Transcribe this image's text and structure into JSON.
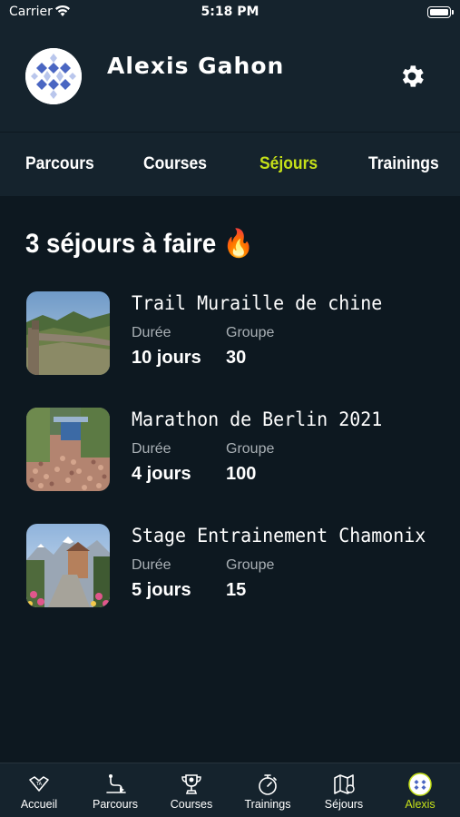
{
  "status_bar": {
    "carrier": "Carrier",
    "time": "5:18 PM"
  },
  "profile": {
    "name": "Alexis Gahon"
  },
  "tabs": [
    {
      "label": "Parcours",
      "active": false
    },
    {
      "label": "Courses",
      "active": false
    },
    {
      "label": "Séjours",
      "active": true
    },
    {
      "label": "Trainings",
      "active": false
    }
  ],
  "main": {
    "title": "3 séjours à faire 🔥"
  },
  "labels": {
    "duration": "Durée",
    "group": "Groupe"
  },
  "trips": [
    {
      "title": "Trail Muraille de chine",
      "duration": "10 jours",
      "group": "30",
      "image": "great-wall-photo"
    },
    {
      "title": "Marathon de Berlin 2021",
      "duration": "4 jours",
      "group": "100",
      "image": "marathon-crowd-photo"
    },
    {
      "title": "Stage Entrainement Chamonix",
      "duration": "5 jours",
      "group": "15",
      "image": "chamonix-photo"
    }
  ],
  "bottom_nav": [
    {
      "label": "Accueil",
      "icon": "home-icon",
      "active": false
    },
    {
      "label": "Parcours",
      "icon": "route-icon",
      "active": false
    },
    {
      "label": "Courses",
      "icon": "trophy-icon",
      "active": false
    },
    {
      "label": "Trainings",
      "icon": "stopwatch-icon",
      "active": false
    },
    {
      "label": "Séjours",
      "icon": "map-icon",
      "active": false
    },
    {
      "label": "Alexis",
      "icon": "avatar-icon",
      "active": true
    }
  ],
  "colors": {
    "accent": "#c5e019",
    "background": "#0d1820",
    "header": "#15232d"
  }
}
